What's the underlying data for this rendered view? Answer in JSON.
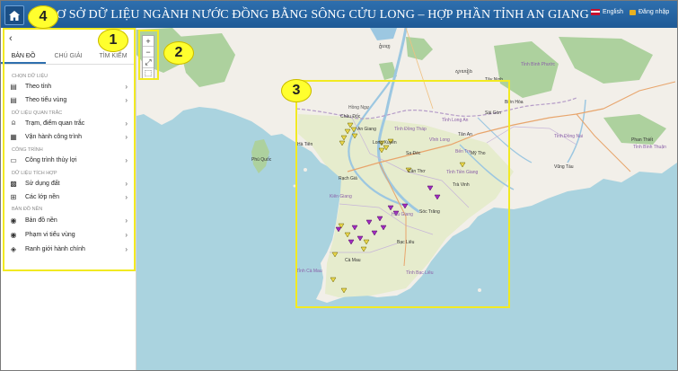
{
  "header": {
    "title": "Ơ SỞ DỮ LIỆU NGÀNH NƯỚC ĐỒNG BẰNG SÔNG CỬU LONG – HỢP PHẦN TỈNH AN GIANG",
    "lang_label": "English",
    "login_label": "Đăng nhập"
  },
  "callouts": [
    "1",
    "2",
    "3",
    "4"
  ],
  "sidebar": {
    "collapse_glyph": "‹",
    "tabs": [
      "BẢN ĐỒ",
      "CHÚ GIẢI",
      "TÌM KIẾM"
    ],
    "sections": [
      "CHỌN DỮ LIỆU",
      "DỮ LIỆU QUAN TRẮC",
      "CÔNG TRÌNH",
      "DỮ LIỆU TÍCH HỢP",
      "BẢN ĐỒ NỀN"
    ],
    "items": [
      {
        "label": "Theo tỉnh",
        "icon": "table-icon"
      },
      {
        "label": "Theo tiểu vùng",
        "icon": "table-icon"
      },
      {
        "label": "Trạm, điểm quan trắc",
        "icon": "antenna-icon"
      },
      {
        "label": "Vận hành công trình",
        "icon": "calendar-icon"
      },
      {
        "label": "Công trình thủy lợi",
        "icon": "monitor-icon"
      },
      {
        "label": "Sử dụng đất",
        "icon": "grid-icon"
      },
      {
        "label": "Các lớp nền",
        "icon": "map-icon"
      },
      {
        "label": "Bản đồ nền",
        "icon": "globe-icon"
      },
      {
        "label": "Phạm vi tiểu vùng",
        "icon": "globe-icon"
      },
      {
        "label": "Ranh giới hành chính",
        "icon": "layers-icon"
      }
    ]
  },
  "zoom": {
    "in": "+",
    "out": "−",
    "extent": "⤢",
    "select": "⬚"
  },
  "map": {
    "colors": {
      "sea": "#aad3df",
      "land": "#f2efe9",
      "farm": "#e6eccd",
      "forest": "#add19e",
      "river": "#9cc7e1"
    },
    "labels": [
      {
        "text": "Châu Đốc"
      },
      {
        "text": "An Giang"
      },
      {
        "text": "Hà Tiên"
      },
      {
        "text": "Phú Quốc"
      },
      {
        "text": "Rạch Giá"
      },
      {
        "text": "Long Xuyên"
      },
      {
        "text": "Sa Đéc"
      },
      {
        "text": "Tỉnh Đồng Tháp"
      },
      {
        "text": "Cần Thơ"
      },
      {
        "text": "Vĩnh Long"
      },
      {
        "text": "Bến Tre"
      },
      {
        "text": "Trà Vinh"
      },
      {
        "text": "Sóc Trăng"
      },
      {
        "text": "Bạc Liêu"
      },
      {
        "text": "Cà Mau"
      },
      {
        "text": "Tỉnh Cà Mau"
      },
      {
        "text": "Hậu Giang"
      },
      {
        "text": "Mỹ Tho"
      },
      {
        "text": "Tân An"
      },
      {
        "text": "Sài Gòn"
      },
      {
        "text": "Biên Hòa"
      },
      {
        "text": "Tây Ninh"
      },
      {
        "text": "Tỉnh Bình Phước"
      },
      {
        "text": "Vũng Tàu"
      },
      {
        "text": "Phan Thiết"
      },
      {
        "text": "Tỉnh Bình Thuận"
      },
      {
        "text": "Tỉnh Đồng Nai"
      },
      {
        "text": "Tỉnh Long An"
      },
      {
        "text": "Tỉnh Tiền Giang"
      },
      {
        "text": "Tỉnh Bạc Liêu"
      },
      {
        "text": "Kiên Giang"
      },
      {
        "text": "Hồng Ngự"
      },
      {
        "text": "ភ្នំពេញ"
      },
      {
        "text": "ស្វាយរៀង"
      }
    ]
  }
}
